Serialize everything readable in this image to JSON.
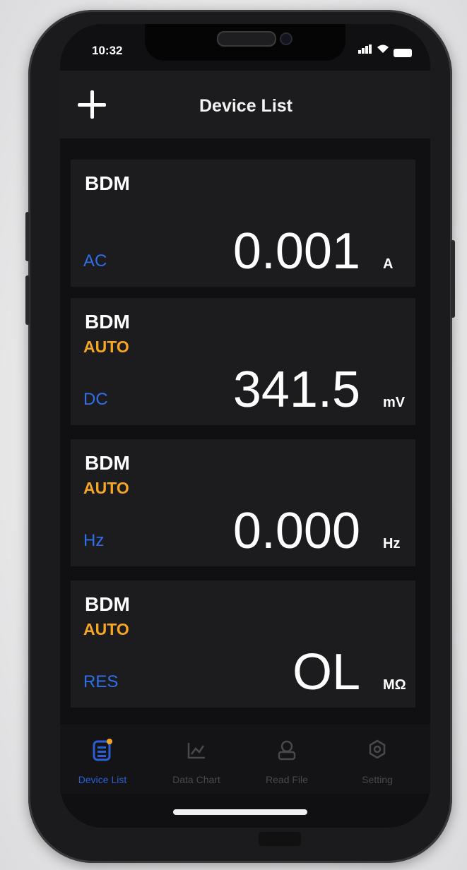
{
  "status_bar": {
    "time": "10:32"
  },
  "header": {
    "title": "Device List",
    "add_icon": "plus-icon"
  },
  "devices": [
    {
      "name": "BDM",
      "range": "",
      "mode": "AC",
      "value": "0.001",
      "unit": "A"
    },
    {
      "name": "BDM",
      "range": "AUTO",
      "mode": "DC",
      "value": "341.5",
      "unit": "mV"
    },
    {
      "name": "BDM",
      "range": "AUTO",
      "mode": "Hz",
      "value": "0.000",
      "unit": "Hz"
    },
    {
      "name": "BDM",
      "range": "AUTO",
      "mode": "RES",
      "value": "OL",
      "unit": "MΩ"
    }
  ],
  "tabs": [
    {
      "label": "Device List",
      "icon": "device-list-icon",
      "active": true
    },
    {
      "label": "Data Chart",
      "icon": "chart-icon",
      "active": false
    },
    {
      "label": "Read File",
      "icon": "file-icon",
      "active": false
    },
    {
      "label": "Setting",
      "icon": "gear-icon",
      "active": false
    }
  ],
  "colors": {
    "accent_blue": "#2f6fe8",
    "range_orange": "#f6a623",
    "card_bg": "#1c1c1e",
    "screen_bg": "#101012"
  }
}
